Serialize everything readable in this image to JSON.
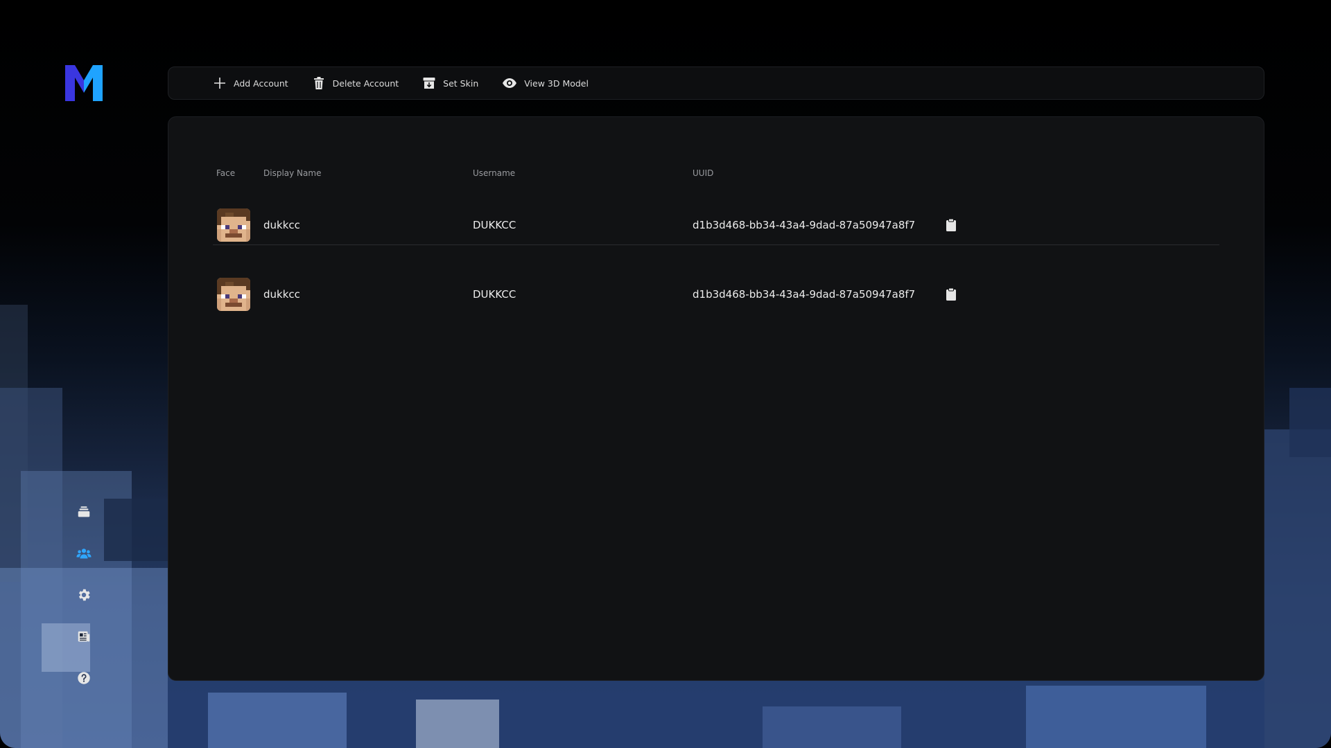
{
  "app": {
    "logo_letter": "M"
  },
  "sidebar": {
    "items": [
      {
        "name": "instances",
        "icon": "stack-icon",
        "active": false
      },
      {
        "name": "accounts",
        "icon": "users-icon",
        "active": true
      },
      {
        "name": "settings",
        "icon": "gear-icon",
        "active": false
      },
      {
        "name": "news",
        "icon": "newspaper-icon",
        "active": false
      },
      {
        "name": "help",
        "icon": "question-icon",
        "active": false
      }
    ],
    "active_color": "#2fa6ff"
  },
  "toolbar": {
    "add_label": "Add Account",
    "delete_label": "Delete Account",
    "skin_label": "Set Skin",
    "model_label": "View 3D Model"
  },
  "table": {
    "headers": {
      "face": "Face",
      "display_name": "Display Name",
      "username": "Username",
      "uuid": "UUID"
    },
    "rows": [
      {
        "display_name": "dukkcc",
        "username": "DUKKCC",
        "uuid": "d1b3d468-bb34-43a4-9dad-87a50947a8f7"
      },
      {
        "display_name": "dukkcc",
        "username": "DUKKCC",
        "uuid": "d1b3d468-bb34-43a4-9dad-87a50947a8f7"
      }
    ]
  }
}
